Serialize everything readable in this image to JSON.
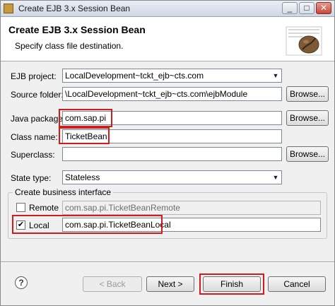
{
  "window": {
    "title": "Create EJB 3.x Session Bean",
    "min_label": "_",
    "max_label": "□",
    "close_label": "✕"
  },
  "header": {
    "title": "Create EJB 3.x Session Bean",
    "subtitle": "Specify class file destination."
  },
  "form": {
    "ejb_project_label": "EJB project:",
    "ejb_project_value": "LocalDevelopment~tckt_ejb~cts.com",
    "source_folder_label": "Source folder:",
    "source_folder_value": "\\LocalDevelopment~tckt_ejb~cts.com\\ejbModule",
    "java_package_label": "Java package:",
    "java_package_value": "com.sap.pi",
    "class_name_label": "Class name:",
    "class_name_value": "TicketBean",
    "superclass_label": "Superclass:",
    "superclass_value": "",
    "state_type_label": "State type:",
    "state_type_value": "Stateless",
    "browse_label": "Browse..."
  },
  "business_interface": {
    "group_title": "Create business interface",
    "remote_label": "Remote",
    "remote_checked": false,
    "remote_value": "com.sap.pi.TicketBeanRemote",
    "local_label": "Local",
    "local_checked": true,
    "local_value": "com.sap.pi.TicketBeanLocal"
  },
  "footer": {
    "help_label": "?",
    "back_label": "< Back",
    "next_label": "Next >",
    "finish_label": "Finish",
    "cancel_label": "Cancel"
  },
  "colors": {
    "highlight": "#d01c1c",
    "header_bg": "#ffffff",
    "dialog_bg": "#f0f0f0"
  },
  "icons": [
    "app-icon",
    "coffee-bean-icon",
    "chevron-down-icon",
    "check-icon",
    "help-icon"
  ]
}
